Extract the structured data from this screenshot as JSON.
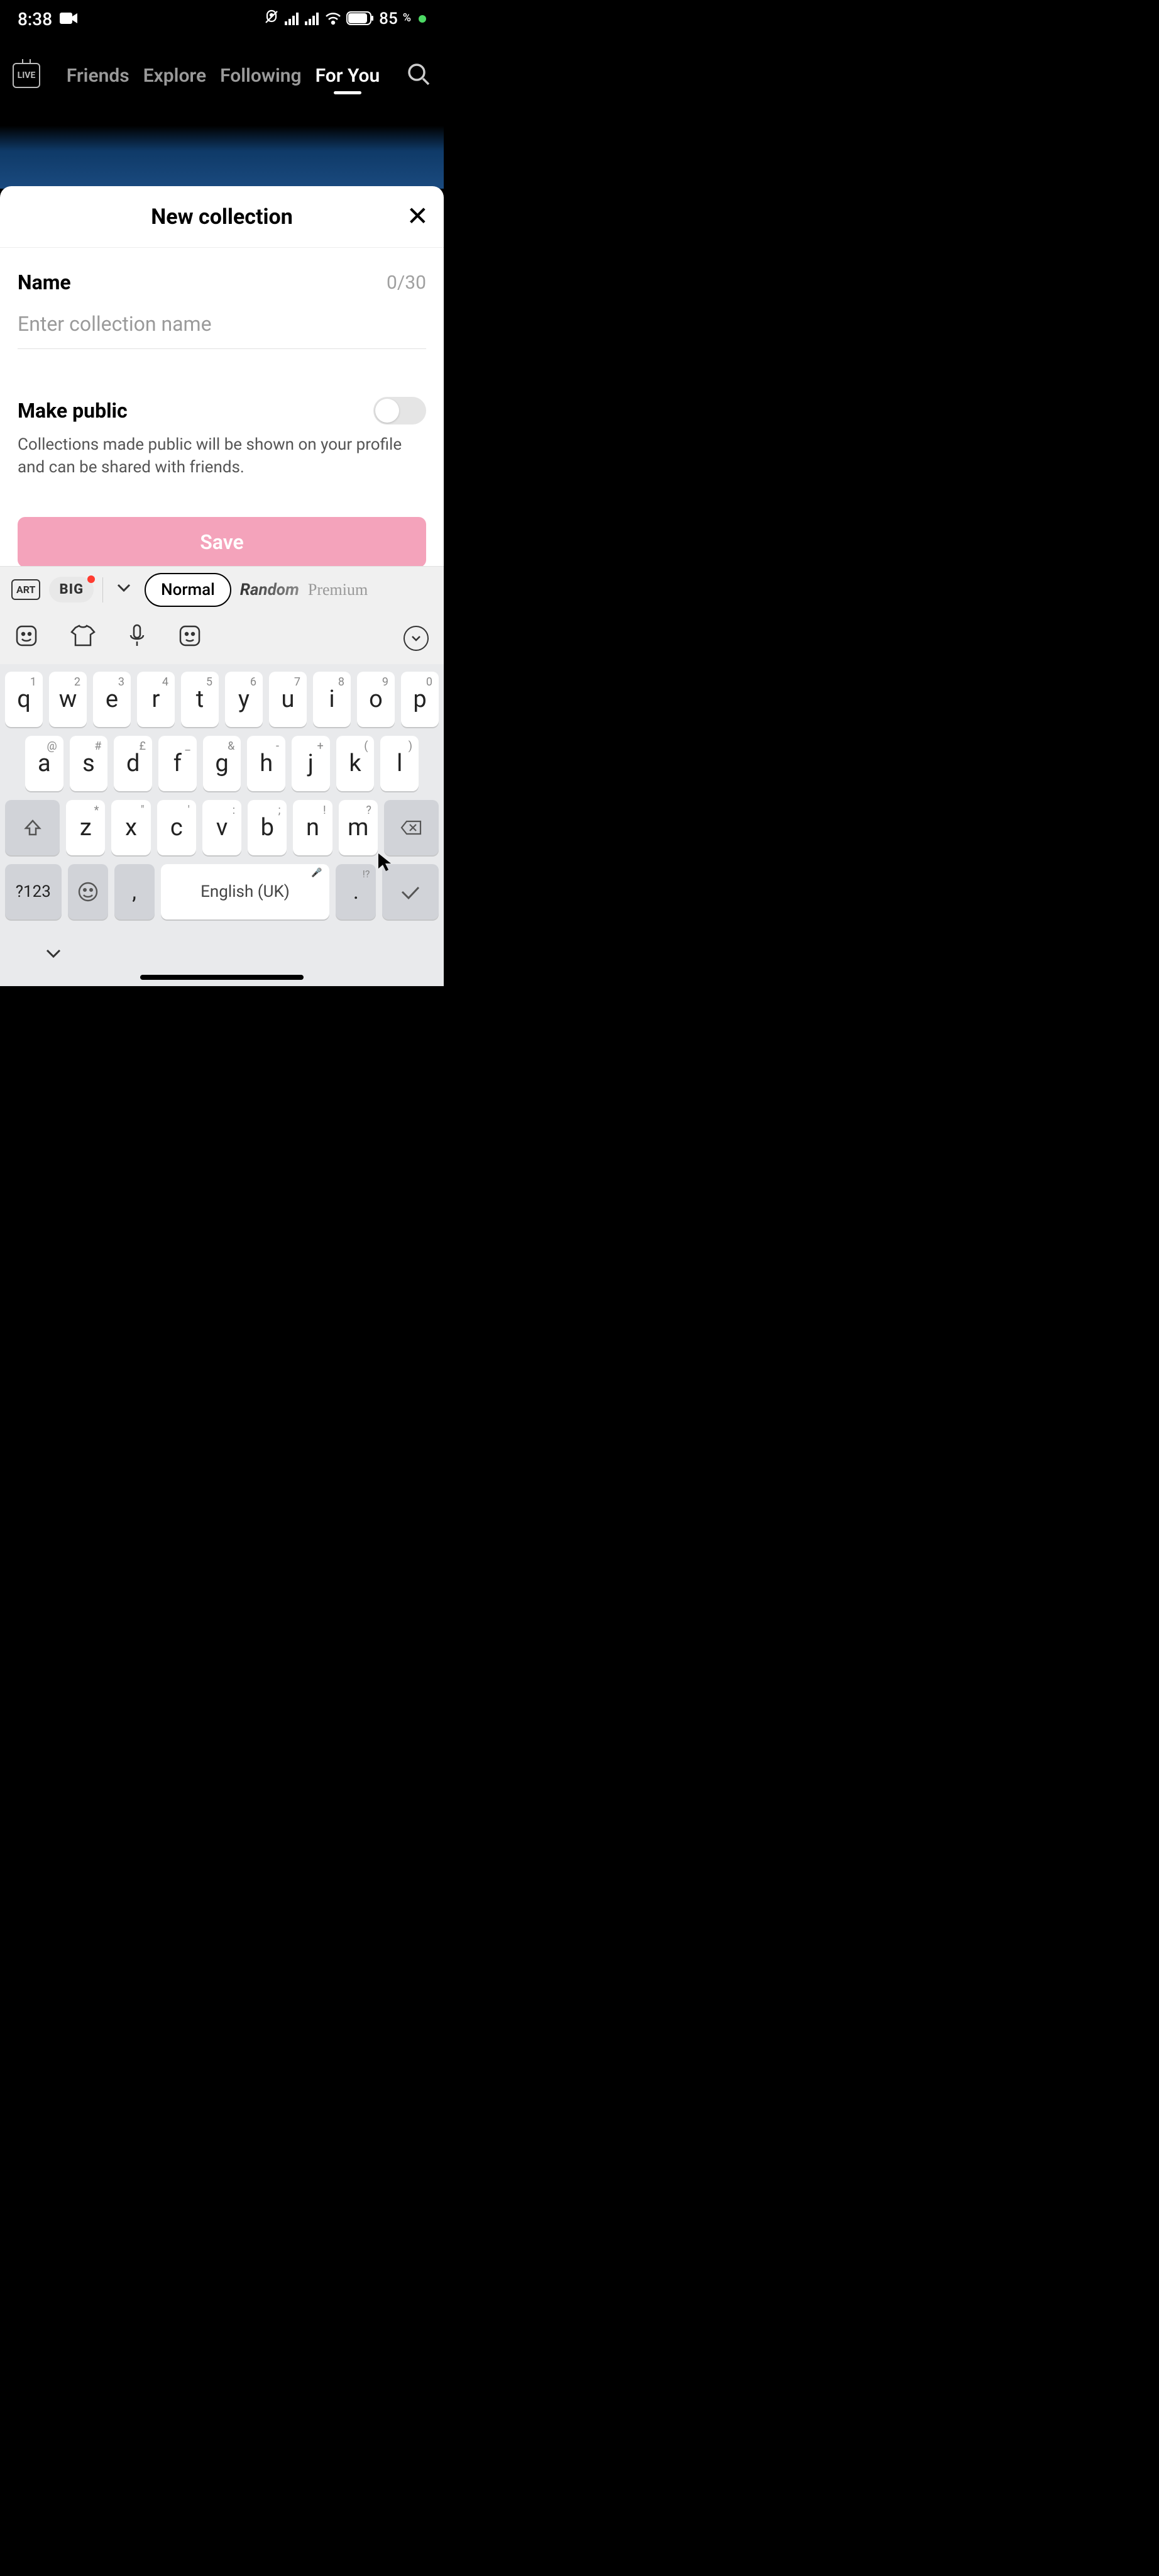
{
  "status": {
    "time": "8:38",
    "battery": "85",
    "battery_pct": "%"
  },
  "nav": {
    "live": "LIVE",
    "tabs": [
      "Friends",
      "Explore",
      "Following",
      "For You"
    ],
    "active_index": 3
  },
  "sheet": {
    "title": "New collection",
    "name_label": "Name",
    "char_count": "0/30",
    "name_placeholder": "Enter collection name",
    "name_value": "",
    "public_label": "Make public",
    "public_desc": "Collections made public will be shown on your profile and can be shared with friends.",
    "public_on": false,
    "save_label": "Save"
  },
  "kb_strip": {
    "art": "ART",
    "big": "BIG",
    "styles": [
      "Normal",
      "Random",
      "Premium"
    ],
    "selected_style": 0
  },
  "keyboard": {
    "row1": [
      {
        "main": "q",
        "sub": "1"
      },
      {
        "main": "w",
        "sub": "2"
      },
      {
        "main": "e",
        "sub": "3"
      },
      {
        "main": "r",
        "sub": "4"
      },
      {
        "main": "t",
        "sub": "5"
      },
      {
        "main": "y",
        "sub": "6"
      },
      {
        "main": "u",
        "sub": "7"
      },
      {
        "main": "i",
        "sub": "8"
      },
      {
        "main": "o",
        "sub": "9"
      },
      {
        "main": "p",
        "sub": "0"
      }
    ],
    "row2": [
      {
        "main": "a",
        "sub": "@"
      },
      {
        "main": "s",
        "sub": "#"
      },
      {
        "main": "d",
        "sub": "£"
      },
      {
        "main": "f",
        "sub": "_"
      },
      {
        "main": "g",
        "sub": "&"
      },
      {
        "main": "h",
        "sub": "-"
      },
      {
        "main": "j",
        "sub": "+"
      },
      {
        "main": "k",
        "sub": "("
      },
      {
        "main": "l",
        "sub": ")"
      }
    ],
    "row3": [
      {
        "main": "z",
        "sub": "*"
      },
      {
        "main": "x",
        "sub": "\""
      },
      {
        "main": "c",
        "sub": "'"
      },
      {
        "main": "v",
        "sub": ":"
      },
      {
        "main": "b",
        "sub": ";"
      },
      {
        "main": "n",
        "sub": "!"
      },
      {
        "main": "m",
        "sub": "?"
      }
    ],
    "sym": "?123",
    "comma": ",",
    "space": "English (UK)",
    "period": ".",
    "period_sub": "!?"
  }
}
